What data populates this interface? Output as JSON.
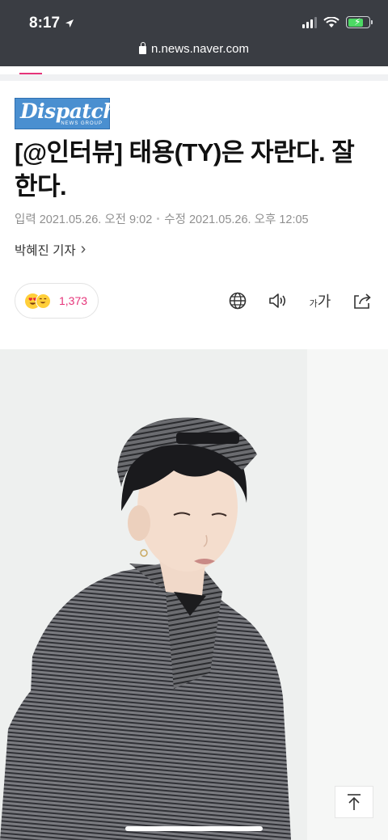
{
  "status_bar": {
    "time": "8:17",
    "url": "n.news.naver.com"
  },
  "brand": {
    "logo_text": "Dispatch",
    "logo_subtext": "NEWS GROUP"
  },
  "article": {
    "title": "[@인터뷰] 태용(TY)은 자란다. 잘한다.",
    "published": "입력 2021.05.26. 오전 9:02",
    "modified": "수정 2021.05.26. 오후 12:05",
    "reporter": "박혜진 기자",
    "reporter_arrow": "›"
  },
  "reactions": {
    "count": "1,373"
  },
  "toolbar": {
    "font_small": "가",
    "font_large": "가"
  },
  "colors": {
    "accent": "#e6347a",
    "status_bar_bg": "#3a3d43"
  },
  "icons": [
    "location-arrow-icon",
    "signal-icon",
    "wifi-icon",
    "battery-icon",
    "lock-icon",
    "globe-icon",
    "speaker-icon",
    "font-size-icon",
    "share-icon",
    "scroll-top-icon"
  ]
}
